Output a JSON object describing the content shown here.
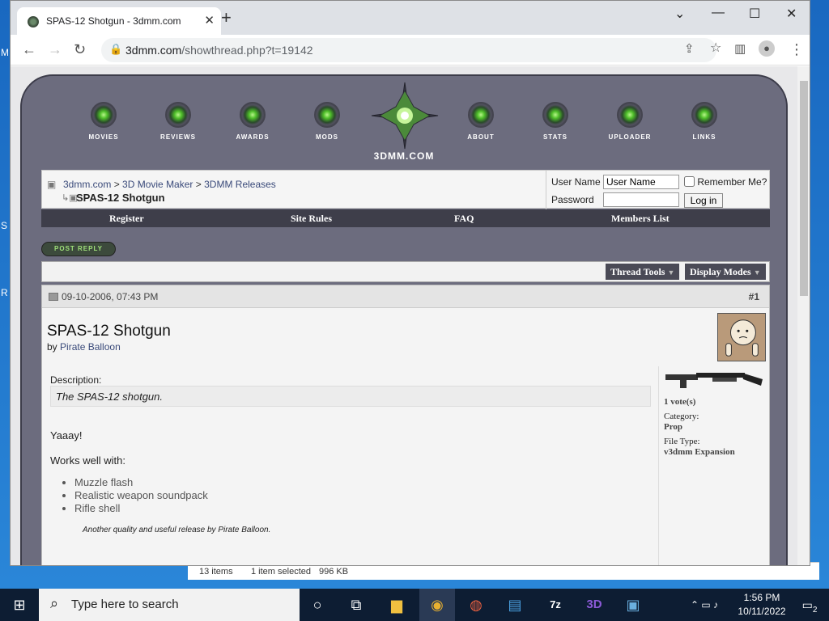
{
  "window": {
    "tab_title": "SPAS-12 Shotgun - 3dmm.com",
    "url_host": "3dmm.com",
    "url_path": "/showthread.php?t=19142"
  },
  "site": {
    "name": "3DMM.COM",
    "nav": [
      "MOVIES",
      "REVIEWS",
      "AWARDS",
      "MODS",
      "ABOUT",
      "STATS",
      "UPLOADER",
      "LINKS"
    ]
  },
  "breadcrumb": {
    "items": [
      "3dmm.com",
      "3D Movie Maker",
      "3DMM Releases"
    ],
    "separator": ">",
    "thread_title": "SPAS-12 Shotgun"
  },
  "login": {
    "username_label": "User Name",
    "username_value": "User Name",
    "password_label": "Password",
    "remember_label": "Remember Me?",
    "login_button": "Log in"
  },
  "menu": [
    "Register",
    "Site Rules",
    "FAQ",
    "Members List"
  ],
  "post_reply": "POST REPLY",
  "tools": {
    "thread_tools": "Thread Tools",
    "display_modes": "Display Modes"
  },
  "post": {
    "date": "09-10-2006, 07:43 PM",
    "number": "#1",
    "title": "SPAS-12 Shotgun",
    "by_label": "by",
    "author": "Pirate Balloon",
    "description_label": "Description:",
    "description": "The SPAS-12 shotgun.",
    "body_line1": "Yaaay!",
    "body_line2": "Works well with:",
    "list": [
      "Muzzle flash",
      "Realistic weapon soundpack",
      "Rifle shell"
    ],
    "signature": "Another quality and useful release by Pirate Balloon.",
    "votes": "1 vote(s)",
    "category_label": "Category:",
    "category": "Prop",
    "filetype_label": "File Type:",
    "filetype": "v3dmm Expansion"
  },
  "explorer": {
    "items": "13 items",
    "selected": "1 item selected",
    "size": "996 KB"
  },
  "taskbar": {
    "search_placeholder": "Type here to search",
    "time": "1:56 PM",
    "date": "10/11/2022",
    "notif_count": "2"
  },
  "colors": {
    "frame": "#6c6c7e",
    "menubar": "#3e3e4a",
    "accent_green": "#4fbf2a"
  }
}
